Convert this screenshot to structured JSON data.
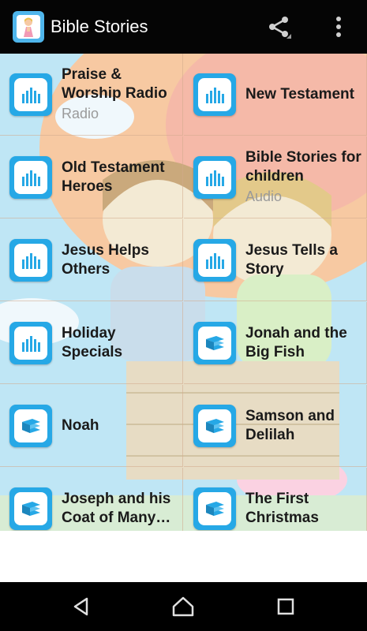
{
  "appbar": {
    "title": "Bible Stories",
    "icon": "praying-child-icon",
    "actions": [
      "share-icon",
      "overflow-menu-icon"
    ]
  },
  "items": [
    {
      "title": "Praise & Worship Radio",
      "subtitle": "Radio",
      "icon": "radio-icon"
    },
    {
      "title": "New Testament",
      "subtitle": "",
      "icon": "radio-icon"
    },
    {
      "title": "Old Testament Heroes",
      "subtitle": "",
      "icon": "radio-icon"
    },
    {
      "title": "Bible Stories for children",
      "subtitle": "Audio",
      "icon": "radio-icon"
    },
    {
      "title": "Jesus Helps Others",
      "subtitle": "",
      "icon": "radio-icon"
    },
    {
      "title": "Jesus Tells a Story",
      "subtitle": "",
      "icon": "radio-icon"
    },
    {
      "title": "Holiday Specials",
      "subtitle": "",
      "icon": "radio-icon"
    },
    {
      "title": "Jonah and the Big Fish",
      "subtitle": "",
      "icon": "book-icon"
    },
    {
      "title": "Noah",
      "subtitle": "",
      "icon": "book-icon"
    },
    {
      "title": "Samson and Delilah",
      "subtitle": "",
      "icon": "book-icon"
    },
    {
      "title": "Joseph and his Coat of Many Colors",
      "subtitle": "",
      "icon": "book-icon"
    },
    {
      "title": "The First Christmas",
      "subtitle": "",
      "icon": "book-icon"
    }
  ],
  "navbar": [
    "back-icon",
    "home-icon",
    "recents-icon"
  ],
  "colors": {
    "appbar": "#050505",
    "icon_blue": "#26a8e6",
    "sky": "#b7e3f4"
  }
}
